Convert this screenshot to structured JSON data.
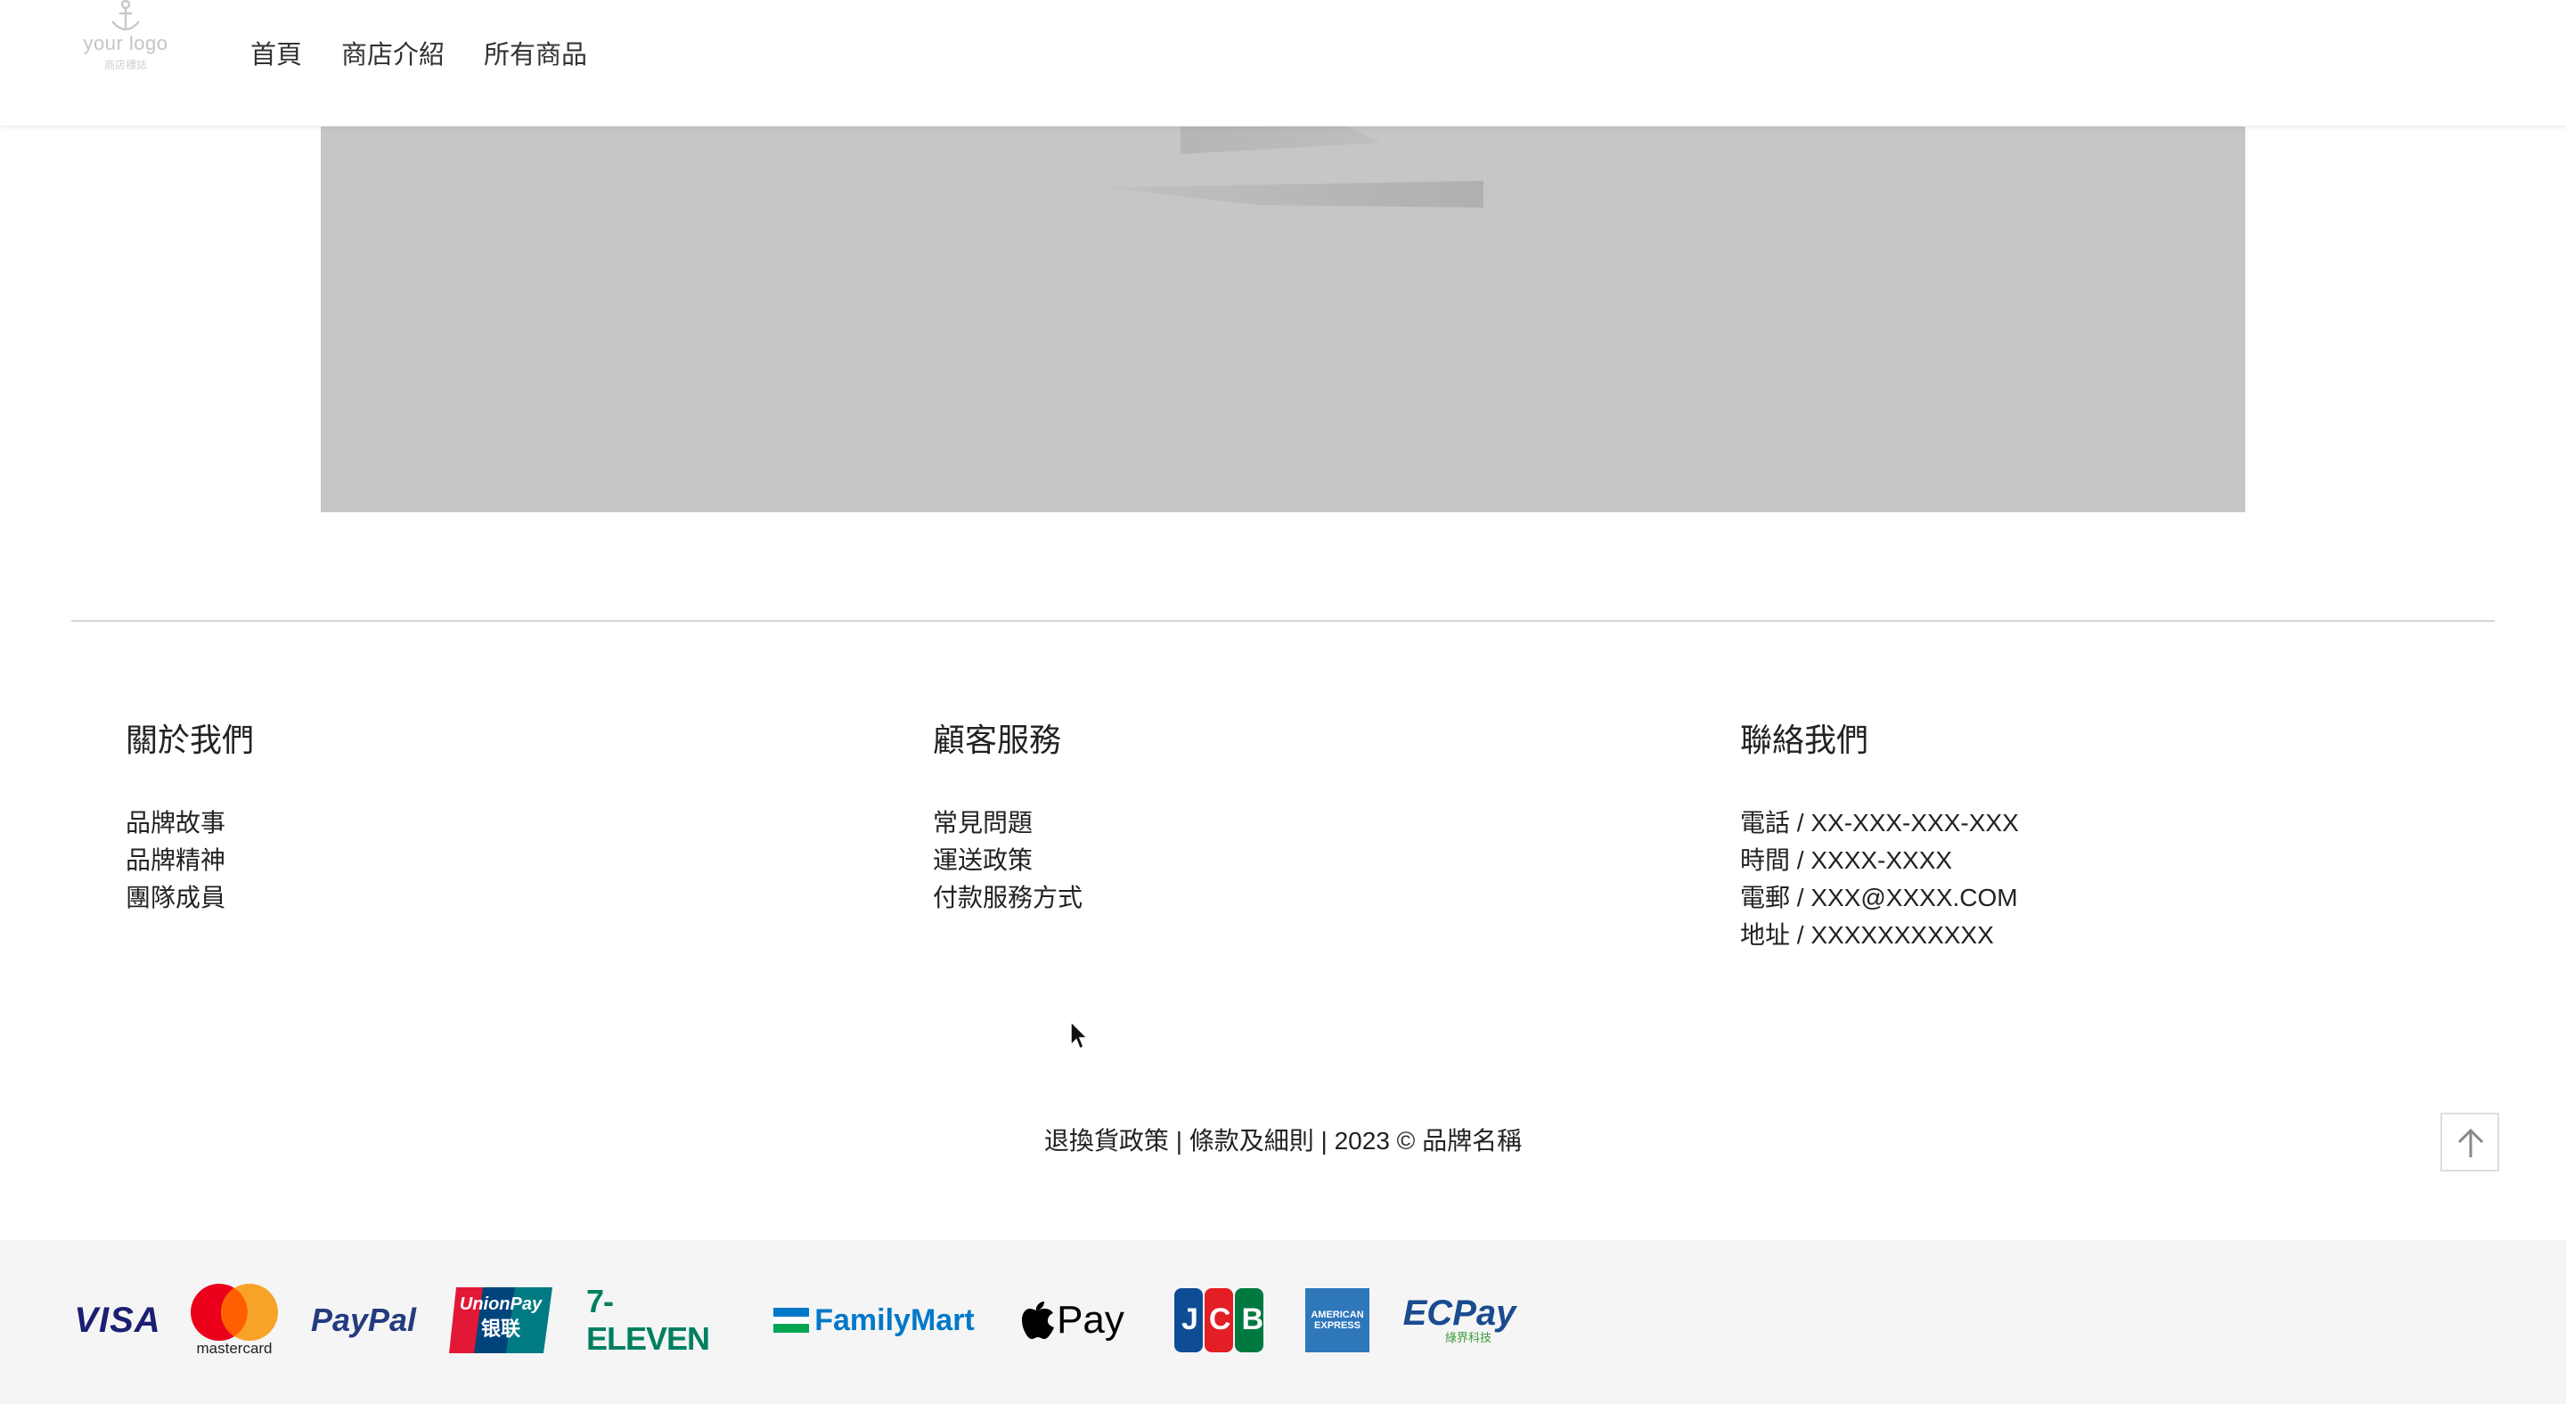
{
  "header": {
    "logo_text": "your logo",
    "logo_sub": "商店標誌",
    "nav": [
      {
        "label": "首頁"
      },
      {
        "label": "商店介紹"
      },
      {
        "label": "所有商品"
      }
    ]
  },
  "footer": {
    "columns": [
      {
        "title": "關於我們",
        "links": [
          "品牌故事",
          "品牌精神",
          "團隊成員"
        ]
      },
      {
        "title": "顧客服務",
        "links": [
          "常見問題",
          "運送政策",
          "付款服務方式"
        ]
      },
      {
        "title": "聯絡我們",
        "lines": [
          "電話 / XX-XXX-XXX-XXX",
          "時間 / XXXX-XXXX",
          "電郵 / XXX@XXXX.COM",
          "地址 / XXXXXXXXXXX"
        ]
      }
    ],
    "bottom": {
      "returns": "退換貨政策",
      "terms": "條款及細則",
      "year_brand": "2023 © 品牌名稱"
    }
  },
  "payments": {
    "visa": "VISA",
    "mastercard": "mastercard",
    "paypal": "PayPal",
    "unionpay": "UnionPay",
    "unionpay_cn": "银联",
    "seven_eleven": "7-ELEVEN",
    "familymart": "FamilyMart",
    "applepay": "Pay",
    "jcb": "JCB",
    "amex_1": "AMERICAN",
    "amex_2": "EXPRESS",
    "ecpay": "ECPay",
    "ecpay_sub": "綠界科技"
  }
}
